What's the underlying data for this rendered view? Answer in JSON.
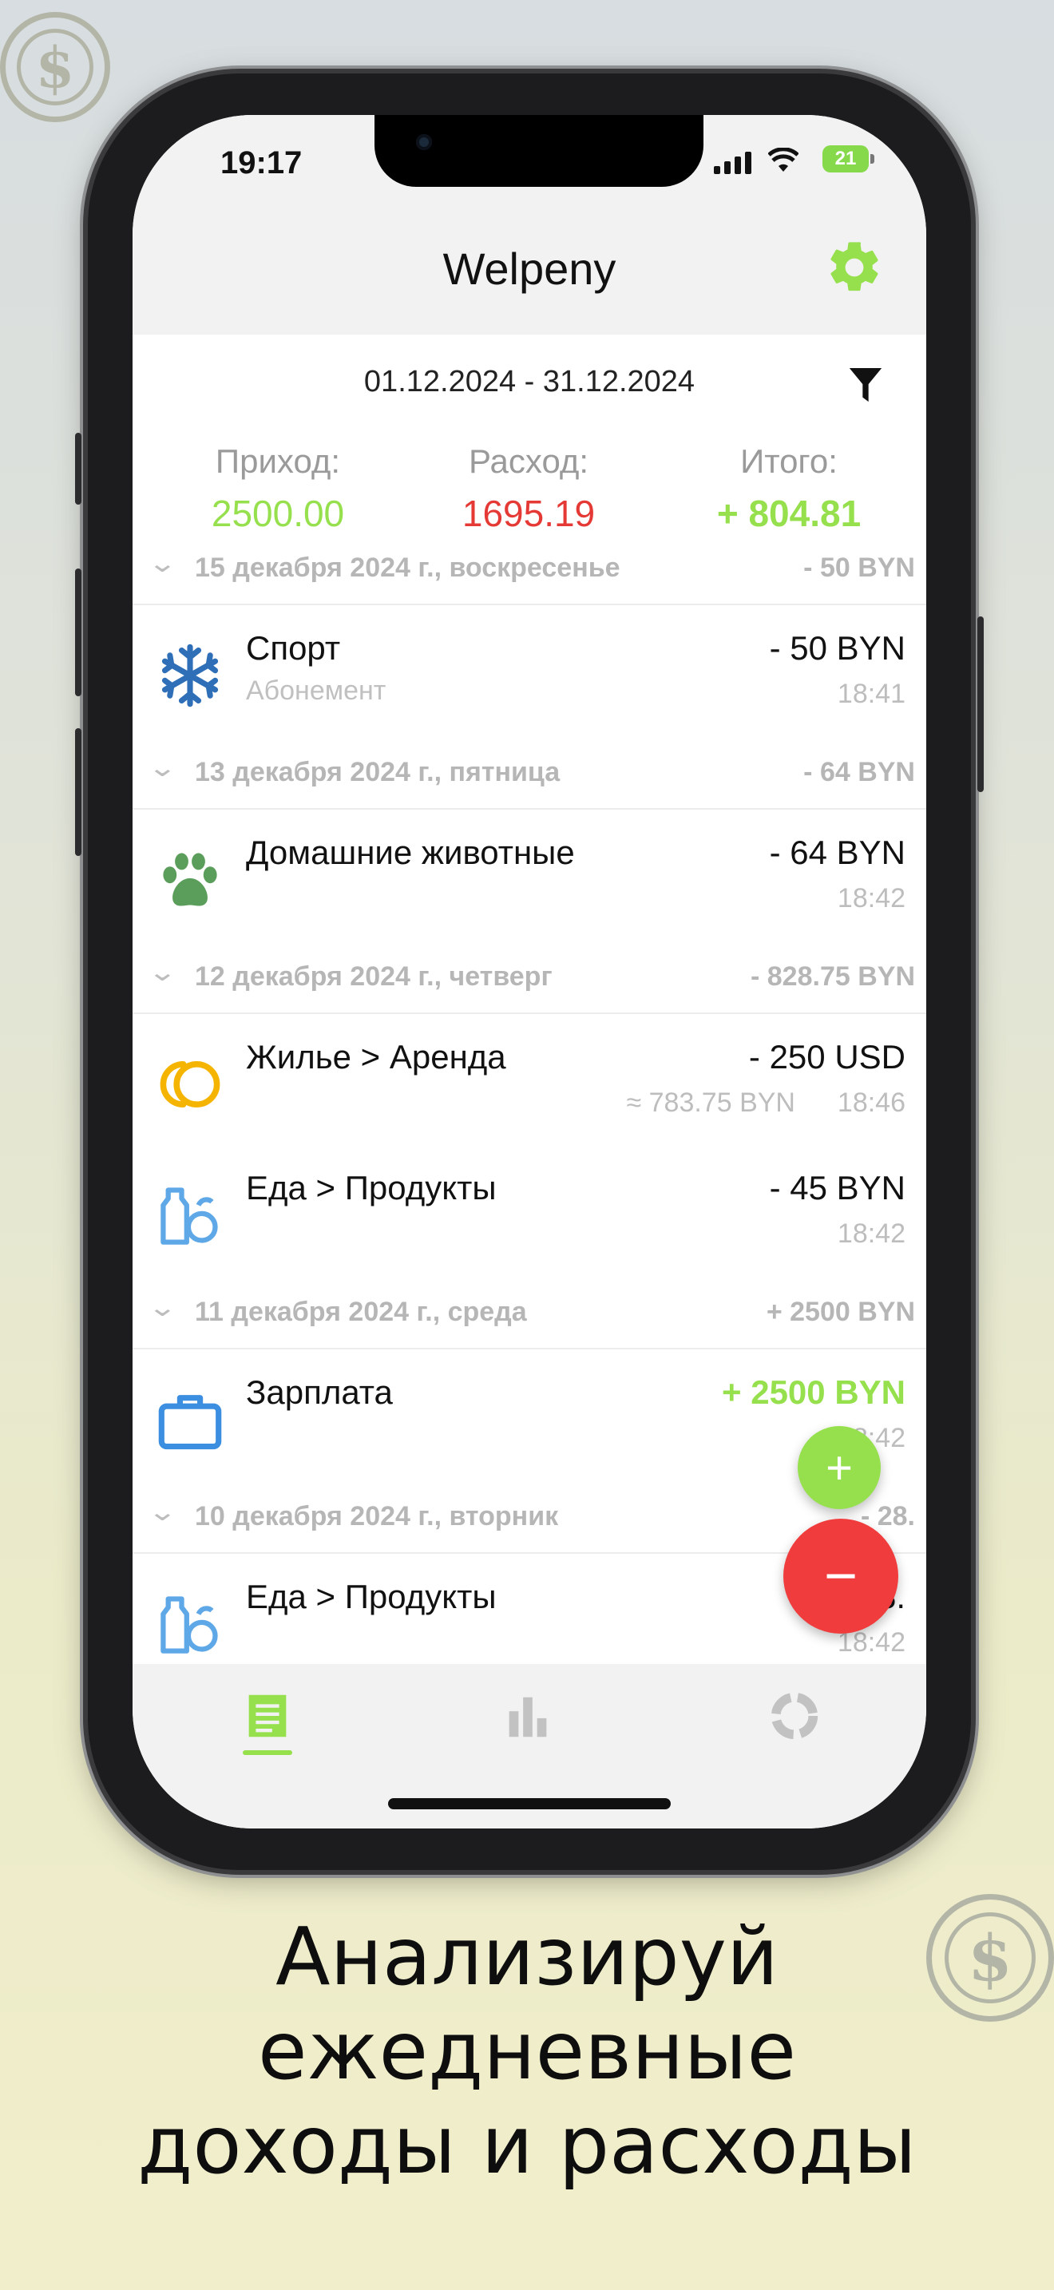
{
  "status_bar": {
    "time": "19:17",
    "battery": "21"
  },
  "header": {
    "title": "Welpeny",
    "settings_icon": "gear-icon"
  },
  "filter": {
    "date_range": "01.12.2024 - 31.12.2024",
    "filter_icon": "funnel-icon"
  },
  "summary": {
    "income_label": "Приход:",
    "income_value": "2500.00",
    "expense_label": "Расход:",
    "expense_value": "1695.19",
    "total_label": "Итого:",
    "total_value": "+ 804.81",
    "colors": {
      "income": "#96e04d",
      "expense": "#e53935",
      "total": "#96e04d"
    }
  },
  "days": [
    {
      "date": "15 декабря 2024 г., воскресенье",
      "total": "- 50 BYN",
      "items": [
        {
          "title": "Спорт",
          "subtitle": "Абонемент",
          "amount": "- 50 BYN",
          "time": "18:41",
          "icon": "snowflake-icon"
        }
      ]
    },
    {
      "date": "13 декабря 2024 г., пятница",
      "total": "- 64 BYN",
      "items": [
        {
          "title": "Домашние животные",
          "amount": "- 64 BYN",
          "time": "18:42",
          "icon": "paw-icon"
        }
      ]
    },
    {
      "date": "12 декабря 2024 г., четверг",
      "total": "- 828.75 BYN",
      "items": [
        {
          "title": "Жилье > Аренда",
          "amount": "- 250 USD",
          "converted": "≈ 783.75 BYN",
          "time": "18:46",
          "icon": "coins-icon"
        },
        {
          "title": "Еда > Продукты",
          "amount": "- 45 BYN",
          "time": "18:42",
          "icon": "groceries-icon"
        }
      ]
    },
    {
      "date": "11 декабря 2024 г., среда",
      "total": "+ 2500 BYN",
      "items": [
        {
          "title": "Зарплата",
          "amount": "+ 2500 BYN",
          "time": "18:42",
          "icon": "briefcase-icon"
        }
      ]
    },
    {
      "date": "10 декабря 2024 г., вторник",
      "total": "- 28.",
      "items": [
        {
          "title": "Еда > Продукты",
          "amount": "- 28.",
          "time": "18:42",
          "icon": "groceries-icon"
        }
      ]
    }
  ],
  "fab": {
    "add": "+",
    "subtract": "−"
  },
  "tabs": [
    "transactions-tab",
    "statistics-tab",
    "budget-tab"
  ],
  "caption": {
    "line1": "Анализируй",
    "line2": "ежедневные",
    "line3": "доходы и расходы"
  }
}
